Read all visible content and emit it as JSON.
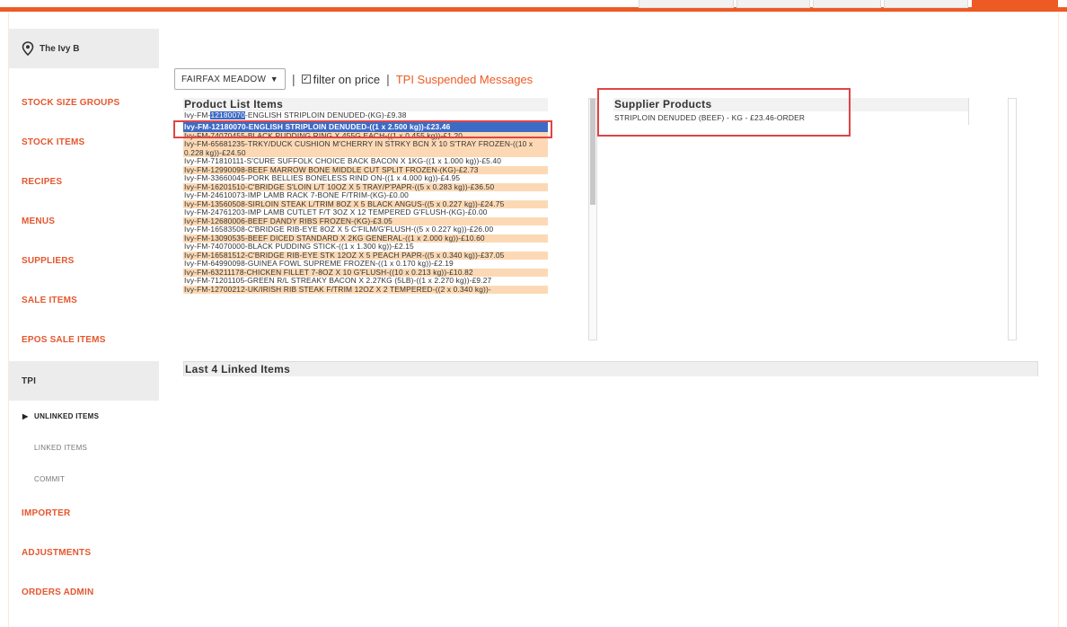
{
  "sidebar": {
    "venue": "The Ivy B",
    "items": [
      {
        "label": "STOCK SIZE GROUPS"
      },
      {
        "label": "STOCK ITEMS"
      },
      {
        "label": "RECIPES"
      },
      {
        "label": "MENUS"
      },
      {
        "label": "SUPPLIERS"
      },
      {
        "label": "SALE ITEMS"
      },
      {
        "label": "EPOS SALE ITEMS"
      },
      {
        "label": "TPI"
      }
    ],
    "sub_items": [
      {
        "label": "UNLINKED ITEMS"
      },
      {
        "label": "LINKED ITEMS"
      },
      {
        "label": "COMMIT"
      }
    ],
    "items_after": [
      {
        "label": "IMPORTER"
      },
      {
        "label": "ADJUSTMENTS"
      },
      {
        "label": "ORDERS ADMIN"
      }
    ]
  },
  "toolbar": {
    "supplier_select": "FAIRFAX MEADOW",
    "filter_label": "filter on price",
    "filter_checked": true,
    "tpi_link": "TPI Suspended Messages"
  },
  "product_list": {
    "title": "Product List Items",
    "first_row": {
      "prefix": "Ivy-FM-",
      "highlight": "12180070",
      "suffix": "-ENGLISH STRIPLOIN DENUDED-(KG)-£9.38"
    },
    "selected": "Ivy-FM-12180070-ENGLISH STRIPLOIN DENUDED-((1 x 2.500 kg))-£23.46",
    "rows": [
      "Ivy-FM-74070455-BLACK PUDDING RING X 455G EACH-((1 x 0.455 kg))-£1.20",
      "Ivy-FM-65681235-TRKY/DUCK CUSHION M'CHERRY IN STRKY BCN X 10 S'TRAY FROZEN-((10 x 0.228 kg))-£24.50",
      "Ivy-FM-71810111-S'CURE SUFFOLK CHOICE BACK BACON X 1KG-((1 x 1.000 kg))-£5.40",
      "Ivy-FM-12990098-BEEF MARROW BONE MIDDLE CUT SPLIT FROZEN-(KG)-£2.73",
      "Ivy-FM-33660045-PORK BELLIES BONELESS RIND ON-((1 x 4.000 kg))-£4.95",
      "Ivy-FM-16201510-C'BRIDGE S'LOIN L/T 10OZ X 5 TRAY/P'PAPR-((5 x 0.283 kg))-£36.50",
      "Ivy-FM-24610073-IMP LAMB RACK 7-BONE F/TRIM-(KG)-£0.00",
      "Ivy-FM-13560508-SIRLOIN STEAK L/TRIM 8OZ X 5 BLACK ANGUS-((5 x 0.227 kg))-£24.75",
      "Ivy-FM-24761203-IMP LAMB CUTLET F/T 3OZ X 12 TEMPERED G'FLUSH-(KG)-£0.00",
      "Ivy-FM-12680006-BEEF DANDY RIBS FROZEN-(KG)-£3.05",
      "Ivy-FM-16583508-C'BRIDGE RIB-EYE 8OZ X 5 C'FILM/G'FLUSH-((5 x 0.227 kg))-£26.00",
      "Ivy-FM-13090535-BEEF DICED STANDARD X 2KG GENERAL-((1 x 2.000 kg))-£10.60",
      "Ivy-FM-74070000-BLACK PUDDING STICK-((1 x 1.300 kg))-£2.15",
      "Ivy-FM-16581512-C'BRIDGE RIB-EYE STK 12OZ X 5 PEACH PAPR-((5 x 0.340 kg))-£37.05",
      "Ivy-FM-64990098-GUINEA FOWL SUPREME FROZEN-((1 x 0.170 kg))-£2.19",
      "Ivy-FM-63211178-CHICKEN FILLET 7-8OZ X 10 G'FLUSH-((10 x 0.213 kg))-£10.82",
      "Ivy-FM-71201105-GREEN R/L STREAKY BACON X 2.27KG (5LB)-((1 x 2.270 kg))-£9.27",
      "Ivy-FM-12700212-UK/IRISH RIB STEAK F/TRIM 12OZ X 2 TEMPERED-((2 x 0.340 kg))-"
    ]
  },
  "supplier_products": {
    "title": "Supplier Products",
    "rows": [
      "STRIPLOIN DENUDED (BEEF) - KG - £23.46-ORDER"
    ]
  },
  "last_linked": {
    "title": "Last 4 Linked Items"
  },
  "colors": {
    "accent": "#ee5a24",
    "row_alt": "#fcd9b4",
    "selection": "#3d6ac5",
    "annotation": "#e04444"
  }
}
